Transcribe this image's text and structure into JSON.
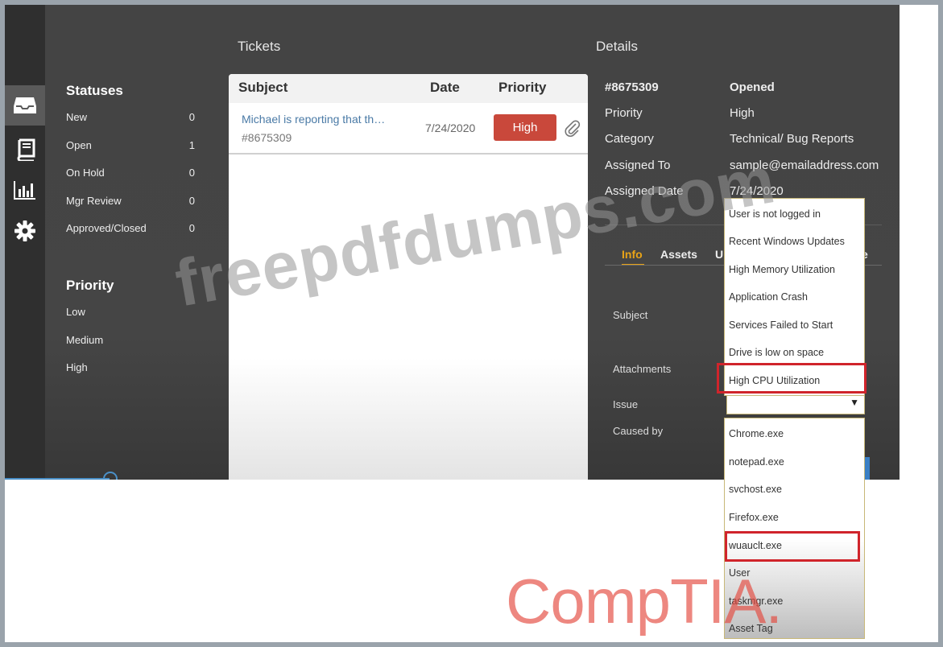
{
  "nav": {
    "icons": [
      "inbox-icon",
      "book-icon",
      "bar-chart-icon",
      "gear-icon"
    ]
  },
  "sidebar": {
    "statuses_title": "Statuses",
    "statuses": [
      {
        "label": "New",
        "count": "0"
      },
      {
        "label": "Open",
        "count": "1"
      },
      {
        "label": "On Hold",
        "count": "0"
      },
      {
        "label": "Mgr Review",
        "count": "0"
      },
      {
        "label": "Approved/Closed",
        "count": "0"
      }
    ],
    "priority_title": "Priority",
    "priorities": [
      "Low",
      "Medium",
      "High"
    ]
  },
  "tickets": {
    "title": "Tickets",
    "columns": {
      "subject": "Subject",
      "date": "Date",
      "priority": "Priority"
    },
    "rows": [
      {
        "subject": "Michael is reporting that th…",
        "id": "#8675309",
        "date": "7/24/2020",
        "priority": "High"
      }
    ]
  },
  "details": {
    "title": "Details",
    "ticket_id": "#8675309",
    "status": "Opened",
    "fields": [
      {
        "label": "Priority",
        "value": "High"
      },
      {
        "label": "Category",
        "value": "Technical/ Bug Reports"
      },
      {
        "label": "Assigned To",
        "value": "sample@emailaddress.com"
      },
      {
        "label": "Assigned Date",
        "value": "7/24/2020"
      }
    ],
    "tabs": [
      "Info",
      "Assets",
      "U",
      "e"
    ],
    "form_labels": {
      "subject": "Subject",
      "attachments": "Attachments",
      "issue": "Issue",
      "caused_by": "Caused by"
    }
  },
  "issue_dropdown": {
    "options": [
      "User is not logged in",
      "Recent Windows Updates",
      "High Memory Utilization",
      "Application Crash",
      "Services Failed to Start",
      "Drive is low on space",
      "High CPU Utilization"
    ],
    "highlighted": "High CPU Utilization"
  },
  "caused_by_dropdown": {
    "options": [
      "Chrome.exe",
      "notepad.exe",
      "svchost.exe",
      "Firefox.exe",
      "wuauclt.exe",
      "User",
      "taskmgr.exe",
      "Asset Tag"
    ],
    "highlighted": "wuauclt.exe"
  },
  "watermark": "freepdfdumps.com",
  "brand": "CompTIA.",
  "colors": {
    "accent": "#e8a317",
    "priority_high": "#c9483b",
    "highlight_border": "#d0242b",
    "link": "#4a7aa6"
  }
}
